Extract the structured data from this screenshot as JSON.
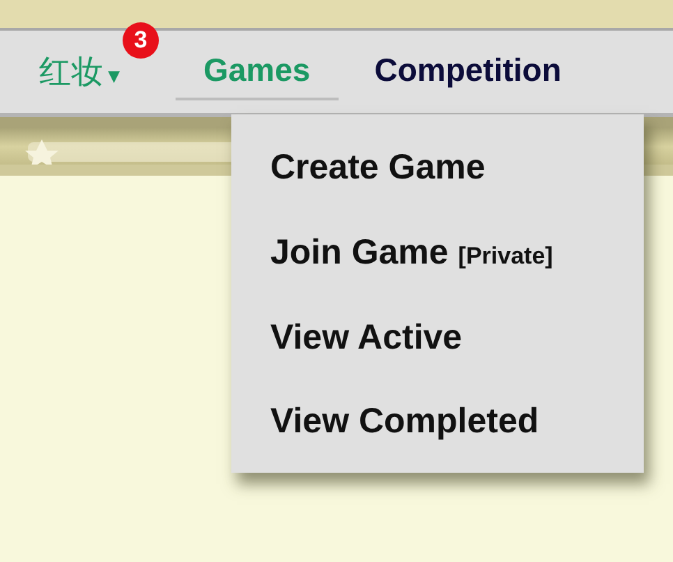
{
  "nav": {
    "user": {
      "name": "红妆",
      "badge": "3",
      "caret": "▾"
    },
    "tabs": [
      {
        "label": "Games",
        "selected": true
      },
      {
        "label": "Competition",
        "selected": false
      }
    ]
  },
  "menu": {
    "items": [
      {
        "label": "Create Game"
      },
      {
        "label": "Join Game",
        "note": "[Private]"
      },
      {
        "label": "View Active"
      },
      {
        "label": "View Completed"
      }
    ]
  }
}
